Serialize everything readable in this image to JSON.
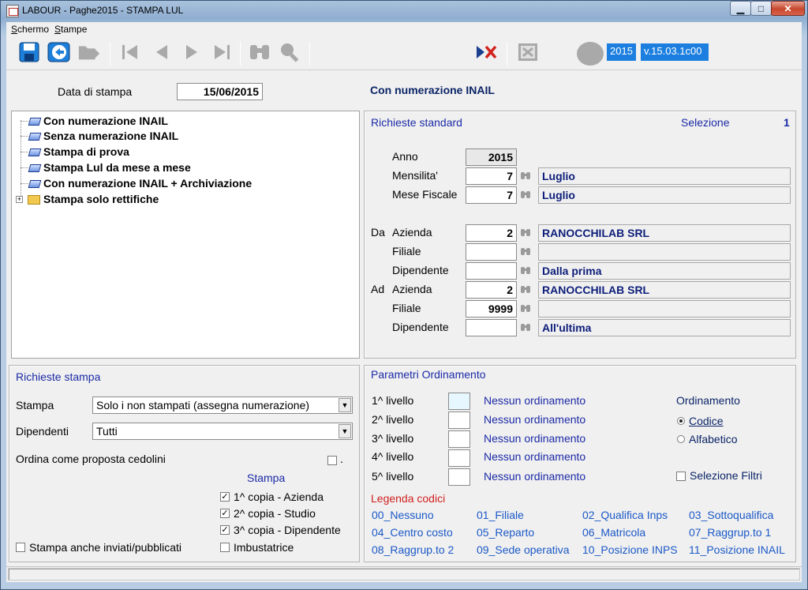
{
  "window": {
    "title": "LABOUR - Paghe2015 - STAMPA LUL"
  },
  "menu": [
    "Schermo",
    "Stampe"
  ],
  "toolbar": {
    "year_badge": "2015",
    "version_badge": "v.15.03.1c00"
  },
  "header": {
    "data_stampa_label": "Data di stampa",
    "data_stampa_value": "15/06/2015",
    "mode_title": "Con numerazione INAIL"
  },
  "tree": {
    "items": [
      "Con numerazione INAIL",
      "Senza numerazione INAIL",
      "Stampa di prova",
      "Stampa Lul da mese a mese",
      "Con numerazione INAIL + Archiviazione",
      "Stampa solo rettifiche"
    ]
  },
  "richieste_standard": {
    "title": "Richieste standard",
    "selezione_label": "Selezione",
    "selezione_value": "1",
    "anno_label": "Anno",
    "anno_value": "2015",
    "mensilita_label": "Mensilita'",
    "mensilita_value": "7",
    "mensilita_desc": "Luglio",
    "mese_label": "Mese Fiscale",
    "mese_value": "7",
    "mese_desc": "Luglio",
    "da_label": "Da",
    "ad_label": "Ad",
    "azienda_label": "Azienda",
    "filiale_label": "Filiale",
    "dipendente_label": "Dipendente",
    "da_azienda_value": "2",
    "da_azienda_desc": "RANOCCHILAB SRL",
    "da_filiale_value": "",
    "da_filiale_desc": "",
    "da_dipendente_value": "",
    "da_dipendente_desc": "Dalla prima",
    "ad_azienda_value": "2",
    "ad_azienda_desc": "RANOCCHILAB SRL",
    "ad_filiale_value": "9999",
    "ad_filiale_desc": "",
    "ad_dipendente_value": "",
    "ad_dipendente_desc": "All'ultima"
  },
  "richieste_stampa": {
    "title": "Richieste stampa",
    "stampa_label": "Stampa",
    "stampa_value": "Solo i non stampati (assegna numerazione)",
    "dipendenti_label": "Dipendenti",
    "dipendenti_value": "Tutti",
    "ordina_label": "Ordina come proposta cedolini",
    "ordina_suffix": ".",
    "stampa_group_title": "Stampa",
    "copia1": "1^ copia - Azienda",
    "copia2": "2^ copia - Studio",
    "copia3": "3^ copia - Dipendente",
    "imbustatrice": "Imbustatrice",
    "anche_inviati": "Stampa anche inviati/pubblicati"
  },
  "parametri": {
    "title": "Parametri Ordinamento",
    "livelli": [
      {
        "label": "1^ livello",
        "value": "Nessun ordinamento"
      },
      {
        "label": "2^ livello",
        "value": "Nessun ordinamento"
      },
      {
        "label": "3^ livello",
        "value": "Nessun ordinamento"
      },
      {
        "label": "4^ livello",
        "value": "Nessun ordinamento"
      },
      {
        "label": "5^ livello",
        "value": "Nessun ordinamento"
      }
    ],
    "ordinamento_label": "Ordinamento",
    "codice": "Codice",
    "alfabetico": "Alfabetico",
    "selezione_filtri": "Selezione Filtri",
    "legenda_title": "Legenda codici",
    "legenda": [
      "00_Nessuno",
      "01_Filiale",
      "02_Qualifica Inps",
      "03_Sottoqualifica",
      "04_Centro costo",
      "05_Reparto",
      "06_Matricola",
      "07_Raggrup.to 1",
      "08_Raggrup.to 2",
      "09_Sede operativa",
      "10_Posizione INPS",
      "11_Posizione INAIL"
    ]
  },
  "colors": {
    "accent_blue": "#1c7fe0",
    "label_blue": "#1b2aa6",
    "legend_red": "#d0201e"
  }
}
